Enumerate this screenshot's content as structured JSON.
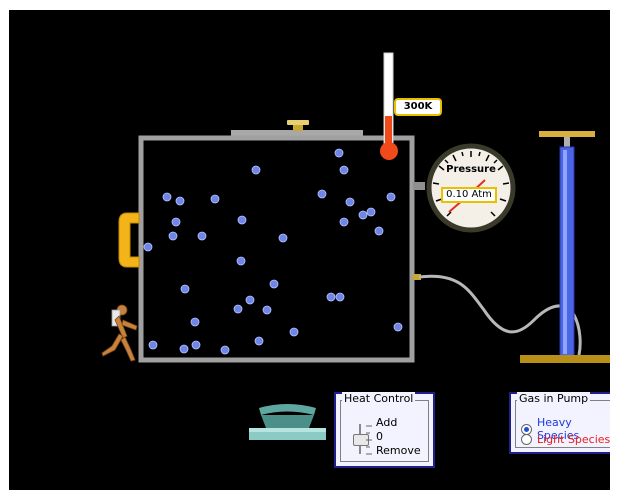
{
  "thermometer": {
    "reading": "300K"
  },
  "gauge": {
    "title": "Pressure",
    "reading": "0.10 Atm"
  },
  "heat_control": {
    "title": "Heat Control",
    "add_label": "Add",
    "zero_label": "0",
    "remove_label": "Remove"
  },
  "gas_in_pump": {
    "title": "Gas in Pump",
    "options": [
      {
        "label": "Heavy Species",
        "color": "#1d39e0",
        "selected": true
      },
      {
        "label": "Light Species",
        "color": "#e8201c",
        "selected": false
      }
    ]
  },
  "colors": {
    "background": "#000000",
    "box_wall": "#a0a0a0",
    "particle": "#6f86e6",
    "thermometer_fluid": "#f04a1a",
    "pump_cylinder": "#4a66e6",
    "handle": "#f0b020"
  }
}
